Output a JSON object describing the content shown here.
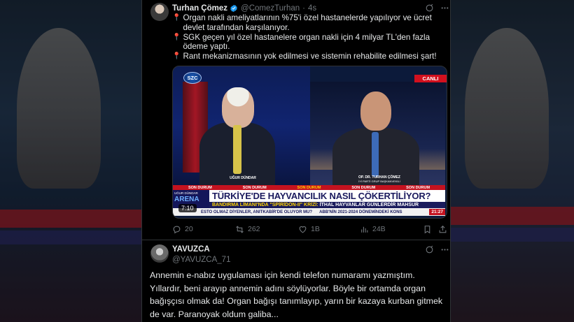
{
  "tweet": {
    "author_name": "Turhan Çömez",
    "author_handle": "@ComezTurhan",
    "time": "4s",
    "lines": [
      "Organ nakli ameliyatlarının %75'i özel hastanelerde yapılıyor ve ücret devlet tarafından karşılanıyor.",
      "SGK geçen yıl özel hastanelere organ nakli için 4 milyar TL'den fazla ödeme yaptı.",
      "Rant mekanizmasının yok edilmesi ve sistemin rehabilite edilmesi şart!"
    ],
    "bullet_icon": "round-pushpin-icon",
    "media": {
      "channel_logo": "SZC",
      "live_label": "CANLI",
      "guest_left_name": "UĞUR DÜNDAR",
      "guest_right_name": "OP. DR. TURHAN ÇÖMEZ",
      "guest_right_title": "İYİ PARTİ GRUP BAŞKANVEKİLİ",
      "ticker_items": [
        "SON DURUM",
        "SON DURUM",
        "SON DURUM",
        "SON DURUM",
        "SON DURUM"
      ],
      "program_top": "UĞUR DÜNDAR",
      "program_name": "ARENA",
      "headline": "TÜRKİYE'DE HAYVANCILIK NASIL ÇÖKERTİLİYOR?",
      "subline_highlight": "BANDIRMA LİMANI'NDA \"SPİRİDON-II\" KRİZİ:",
      "subline_rest": "İTHAL HAYVANLAR GÜNLERDİR MAHSUR",
      "bottom_ticker_1": "ESTO OLMAZ DİYENLER, ANITKABİR'DE OLUYOR MU?",
      "bottom_ticker_2": "ABB'NİN 2021-2024 DÖNEMİNDEKİ KONS",
      "clock": "21:27",
      "video_time": "7:10"
    },
    "actions": {
      "replies": "20",
      "retweets": "262",
      "likes": "1B",
      "views": "24B"
    }
  },
  "reply": {
    "author_name": "YAVUZCA",
    "author_handle": "@YAVUZCA_71",
    "text": "Annemin e-nabız uygulaması için kendi telefon numaramı yazmıştım. Yıllardır, beni arayıp annemin adını söylüyorlar. Böyle bir ortamda organ bağışçısı olmak da! Organ bağışı tanımlayıp, yarın bir kazaya kurban gitmek de var. Paranoyak oldum galiba..."
  },
  "colors": {
    "accent_blue": "#1d9bf0",
    "text_primary": "#e7e9ea",
    "text_secondary": "#71767b",
    "pin_red": "#f4212e"
  }
}
